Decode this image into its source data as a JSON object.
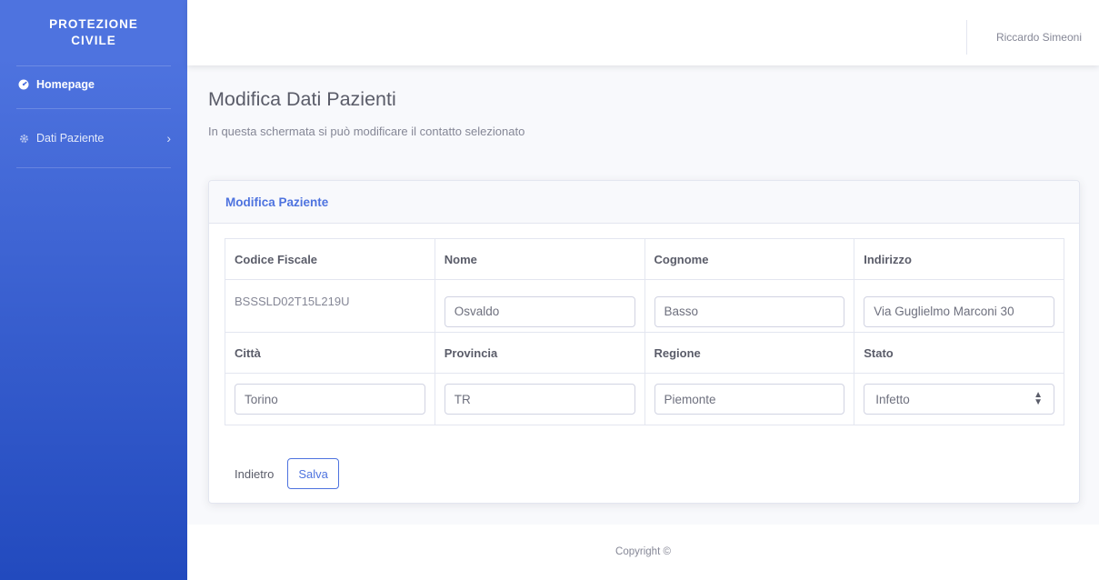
{
  "app": {
    "brand": "PROTEZIONE CIVILE"
  },
  "sidebar": {
    "items": [
      {
        "label": "Homepage",
        "icon": "tachometer-icon"
      },
      {
        "label": "Dati Paziente",
        "icon": "gear-icon"
      }
    ]
  },
  "topbar": {
    "user_name": "Riccardo Simeoni"
  },
  "page": {
    "title": "Modifica Dati Pazienti",
    "subtitle": "In questa schermata si può modificare il contatto selezionato"
  },
  "card": {
    "header": "Modifica Paziente",
    "headers_row1": [
      "Codice Fiscale",
      "Nome",
      "Cognome",
      "Indirizzo"
    ],
    "headers_row2": [
      "Città",
      "Provincia",
      "Regione",
      "Stato"
    ],
    "codice_fiscale": "BSSSLD02T15L219U",
    "nome": "Osvaldo",
    "cognome": "Basso",
    "indirizzo": "Via Guglielmo Marconi 30",
    "citta": "Torino",
    "provincia": "TR",
    "regione": "Piemonte",
    "stato": "Infetto",
    "back_label": "Indietro",
    "save_label": "Salva"
  },
  "footer": {
    "copyright": "Copyright ©"
  },
  "colors": {
    "primary": "#4e73df",
    "sidebar_gradient_end": "#224abe"
  }
}
